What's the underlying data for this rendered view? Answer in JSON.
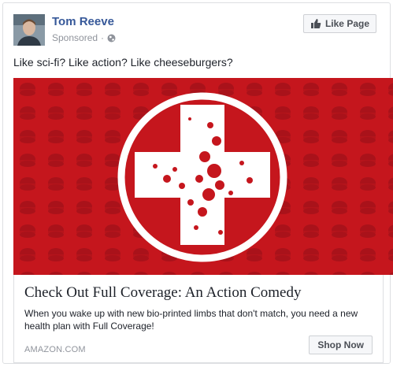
{
  "post": {
    "author": "Tom Reeve",
    "sponsored": "Sponsored",
    "separator": "·",
    "text": "Like sci-fi? Like action? Like cheeseburgers?"
  },
  "like_page": {
    "label": "Like Page",
    "icon": "thumbs-up-icon"
  },
  "ad": {
    "headline": "Check Out Full Coverage: An Action Comedy",
    "description": "When you wake up with new bio-printed limbs that don't match, you need a new health plan with Full Coverage!",
    "domain": "AMAZON.COM",
    "cta": "Shop Now"
  },
  "colors": {
    "author_link": "#365899",
    "image_red": "#c5161d",
    "border": "#dddfe2",
    "meta_gray": "#90949c"
  }
}
